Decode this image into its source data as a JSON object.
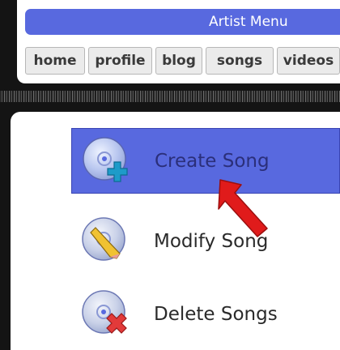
{
  "header": {
    "title": "Artist Menu"
  },
  "nav": {
    "tabs": [
      {
        "label": "home"
      },
      {
        "label": "profile"
      },
      {
        "label": "blog"
      },
      {
        "label": "songs",
        "active": true
      },
      {
        "label": "videos"
      }
    ]
  },
  "actions": [
    {
      "label": "Create Song",
      "icon": "cd-plus-icon",
      "active": true
    },
    {
      "label": "Modify Song",
      "icon": "cd-pencil-icon"
    },
    {
      "label": "Delete Songs",
      "icon": "cd-x-icon"
    }
  ],
  "colors": {
    "accent": "#5869df",
    "arrow": "#e01b1b",
    "plus": "#1e9bc9",
    "delete": "#e23a3a"
  }
}
